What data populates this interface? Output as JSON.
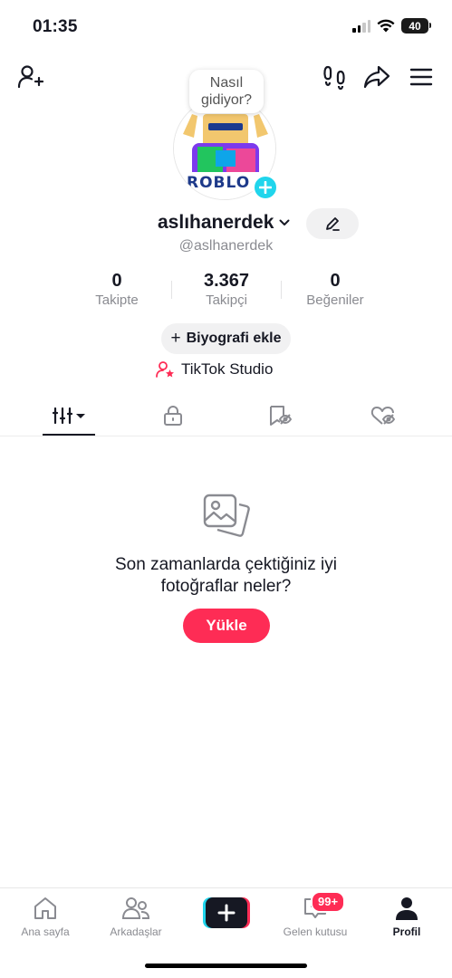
{
  "status": {
    "time": "01:35",
    "battery": "40"
  },
  "bubble": {
    "line1": "Nasıl",
    "line2": "gidiyor?"
  },
  "profile": {
    "username": "aslıhanerdek",
    "handle": "@aslhanerdek"
  },
  "stats": [
    {
      "num": "0",
      "label": "Takipte"
    },
    {
      "num": "3.367",
      "label": "Takipçi"
    },
    {
      "num": "0",
      "label": "Beğeniler"
    }
  ],
  "bio_button": {
    "plus": "+",
    "label": "Biyografi ekle"
  },
  "studio": {
    "label": "TikTok Studio"
  },
  "empty": {
    "line1": "Son zamanlarda çektiğiniz iyi",
    "line2": "fotoğraflar neler?",
    "button": "Yükle"
  },
  "nav": {
    "home": "Ana sayfa",
    "friends": "Arkadaşlar",
    "inbox": "Gelen kutusu",
    "inbox_badge": "99+",
    "profile": "Profil"
  },
  "colors": {
    "accent": "#fe2c55",
    "cyan": "#20d5ec",
    "text": "#161823",
    "muted": "#8a8b91"
  }
}
